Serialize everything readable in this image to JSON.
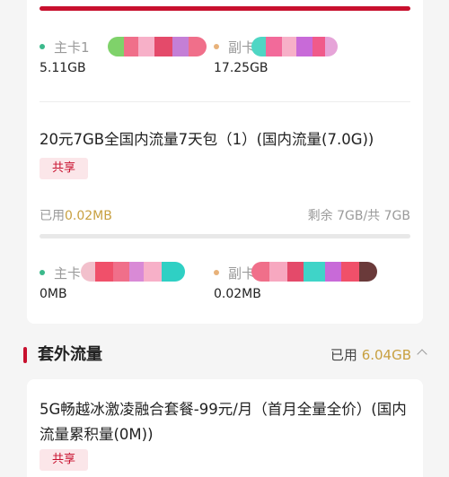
{
  "package1": {
    "primary_label": "主卡1",
    "primary_value": "5.11GB",
    "secondary_label": "副卡",
    "secondary_value": "17.25GB"
  },
  "package2": {
    "title": "20元7GB全国内流量7天包（1）(国内流量(7.0G))",
    "tag": "共享",
    "used_label": "已用",
    "used_value": "0.02MB",
    "remaining": "剩余 7GB/共 7GB",
    "used_fraction": 0.0,
    "primary_label": "主卡",
    "primary_value": "0MB",
    "secondary_label": "副卡",
    "secondary_value": "0.02MB"
  },
  "extra_section": {
    "title": "套外流量",
    "used_label": "已用",
    "used_value": "6.04GB"
  },
  "package3": {
    "title": "5G畅越冰激凌融合套餐-99元/月（首月全量全价）(国内流量累积量(0M))",
    "tag": "共享"
  },
  "colors": {
    "brand_red": "#c8102e",
    "gold": "#c8a040",
    "primary_dot": "#3bb98b",
    "secondary_dot": "#e8b27a"
  },
  "icons": [
    "chevron-up-icon"
  ]
}
